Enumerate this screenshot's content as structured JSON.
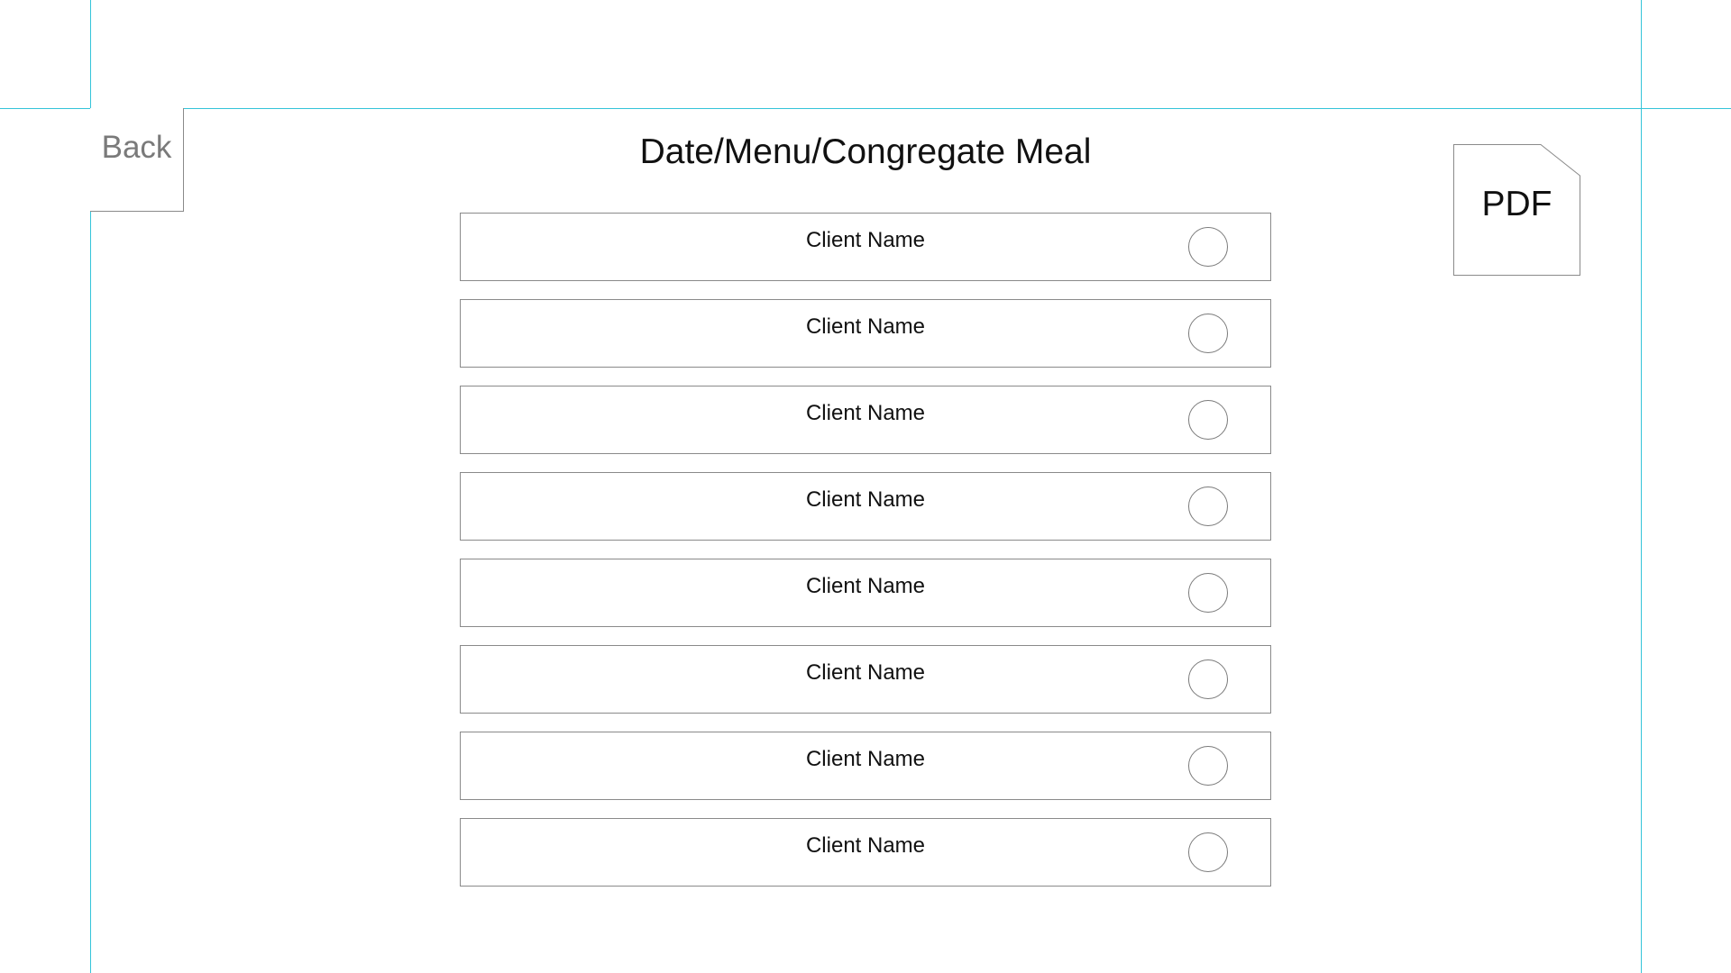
{
  "header": {
    "back_label": "Back",
    "title": "Date/Menu/Congregate Meal",
    "pdf_label": "PDF"
  },
  "clients": [
    {
      "name": "Client Name",
      "selected": false
    },
    {
      "name": "Client Name",
      "selected": false
    },
    {
      "name": "Client Name",
      "selected": false
    },
    {
      "name": "Client Name",
      "selected": false
    },
    {
      "name": "Client Name",
      "selected": false
    },
    {
      "name": "Client Name",
      "selected": false
    },
    {
      "name": "Client Name",
      "selected": false
    },
    {
      "name": "Client Name",
      "selected": false
    }
  ],
  "colors": {
    "guide": "#34c4d9",
    "border": "#8a8a8a",
    "text": "#111111",
    "muted_text": "#7a7a7a"
  }
}
